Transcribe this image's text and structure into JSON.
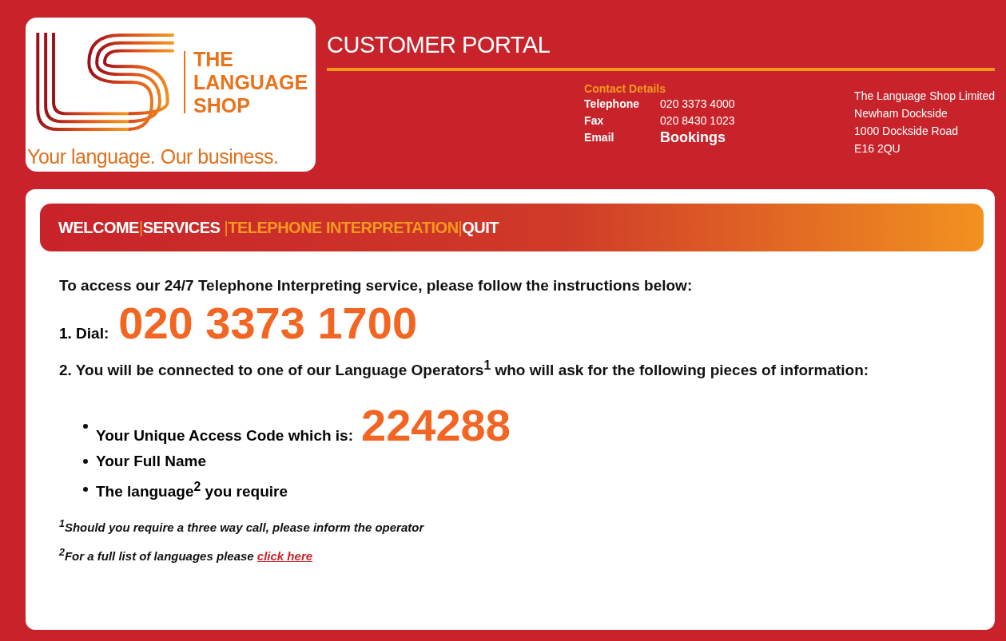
{
  "header": {
    "logo": {
      "name_lines": [
        "THE",
        "LANGUAGE",
        "SHOP"
      ],
      "tagline": "Your language. Our business."
    },
    "title": "CUSTOMER PORTAL",
    "contact": {
      "heading": "Contact Details",
      "rows": [
        {
          "label": "Telephone",
          "value": "020 3373 4000",
          "kind": "text"
        },
        {
          "label": "Fax",
          "value": "020 8430 1023",
          "kind": "text"
        },
        {
          "label": "Email",
          "value": "Bookings",
          "kind": "link"
        }
      ]
    },
    "address": [
      "The Language Shop Limited",
      "Newham Dockside",
      "1000 Dockside Road",
      "E16 2QU"
    ]
  },
  "nav": {
    "separator": "|",
    "items": [
      {
        "label": "WELCOME",
        "selected": false
      },
      {
        "label": "SERVICES ",
        "selected": false
      },
      {
        "label": "TELEPHONE INTERPRETATION",
        "selected": true
      },
      {
        "label": "QUIT",
        "selected": false
      }
    ]
  },
  "content": {
    "intro": "To access our 24/7 Telephone Interpreting service, please follow the instructions below:",
    "step1": {
      "label": "1. Dial:",
      "number": "020 3373 1700"
    },
    "step2": "2. You will be connected to one of our Language Operators$^{1}$ who will ask for the following pieces of information:",
    "bullets": [
      {
        "text": "Your Unique Access Code which is:",
        "code": "224288"
      },
      {
        "text": "Your Full Name"
      },
      {
        "text": "The language$^{2}$ you require"
      }
    ],
    "footnote1": "$^{1}$Should you require a three way call, please inform the operator",
    "footnote2": {
      "text": "$^{2}$For a full list of languages please",
      "link": "click here"
    }
  }
}
